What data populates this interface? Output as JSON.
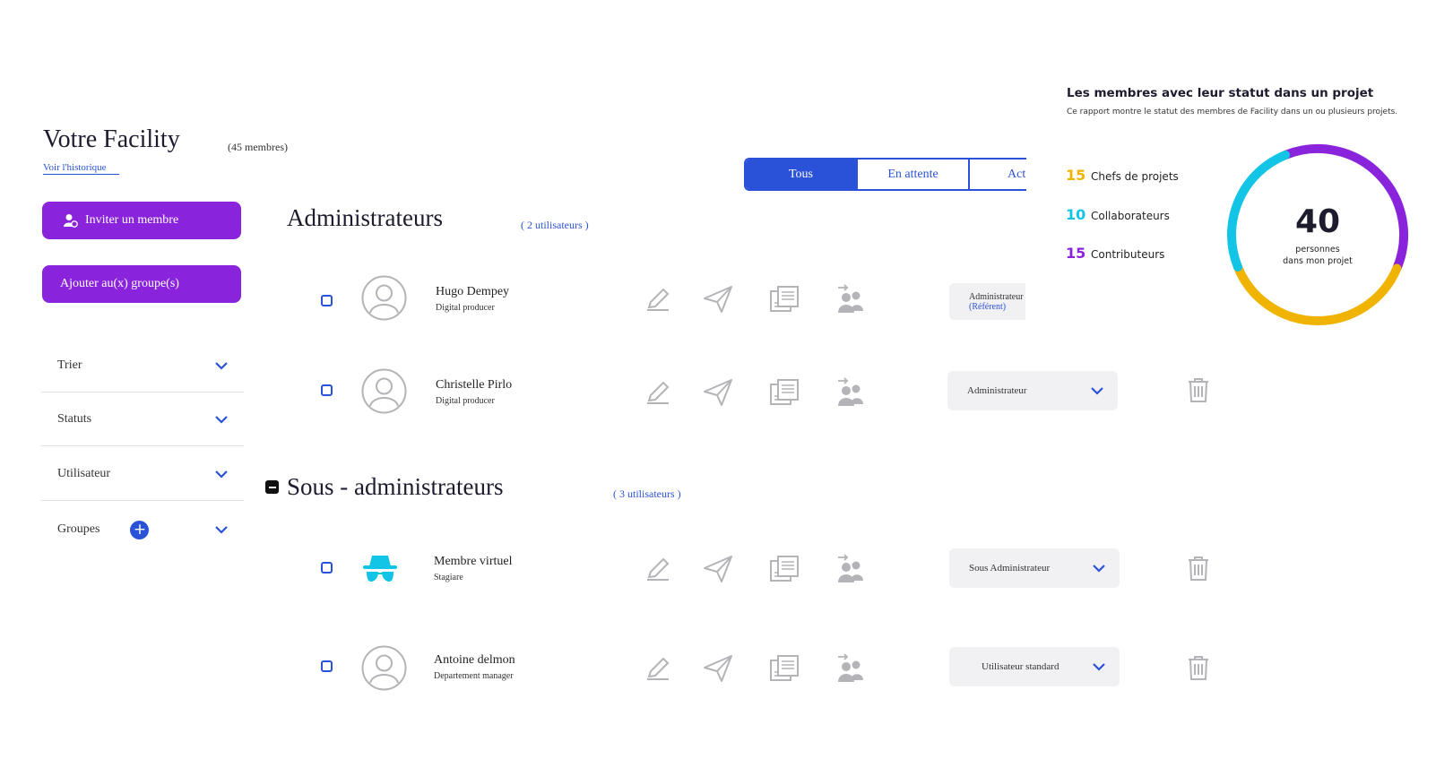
{
  "header": {
    "title": "Votre Facility",
    "member_count": "(45 membres)",
    "history_link": "Voir l'historique"
  },
  "actions": {
    "invite": "Inviter un membre",
    "add_group": "Ajouter au(x) groupe(s)"
  },
  "filters": [
    {
      "label": "Trier"
    },
    {
      "label": "Statuts"
    },
    {
      "label": "Utilisateur"
    },
    {
      "label": "Groupes"
    }
  ],
  "tabs": [
    {
      "label": "Tous",
      "active": true
    },
    {
      "label": "En attente",
      "active": false
    },
    {
      "label": "Act",
      "active": false
    }
  ],
  "sections": [
    {
      "title": "Administrateurs",
      "count": "( 2 utilisateurs )",
      "users": [
        {
          "name": "Hugo Dempey",
          "role": "Digital producer",
          "status": "Administrateur",
          "status_sub": "(Référent)",
          "avatar": "avatar-icon"
        },
        {
          "name": "Christelle Pirlo",
          "role": "Digital producer",
          "status": "Administrateur",
          "avatar": "avatar-icon"
        }
      ]
    },
    {
      "title": "Sous - administrateurs",
      "count": "( 3 utilisateurs )",
      "users": [
        {
          "name": "Membre virtuel",
          "role": "Stagiare",
          "status": "Sous Administrateur",
          "avatar": "incognito-icon"
        },
        {
          "name": "Antoine delmon",
          "role": "Departement manager",
          "status": "Utilisateur standard",
          "avatar": "avatar-icon"
        }
      ]
    }
  ],
  "stats": {
    "title": "Les membres avec leur statut dans un projet",
    "subtitle": "Ce rapport montre le statut des membres de Facility dans un ou plusieurs projets.",
    "items": [
      {
        "value": "15",
        "label": "Chefs de projets",
        "color": "#f0b400"
      },
      {
        "value": "10",
        "label": "Collaborateurs",
        "color": "#12c5e6"
      },
      {
        "value": "15",
        "label": "Contributeurs",
        "color": "#8a24dc"
      }
    ],
    "total": "40",
    "total_label_1": "personnes",
    "total_label_2": "dans mon projet"
  },
  "colors": {
    "primary_blue": "#2a52d8",
    "purple": "#8a24dc",
    "yellow": "#f0b400",
    "cyan": "#12c5e6"
  }
}
